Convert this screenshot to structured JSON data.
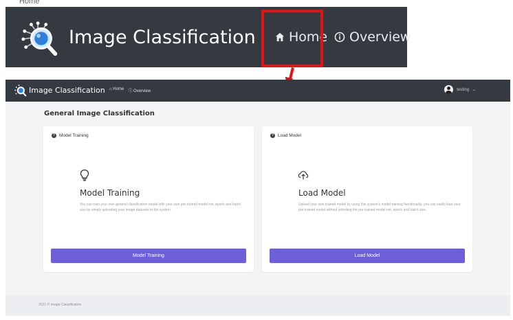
{
  "callout": {
    "top_text": "Home"
  },
  "app": {
    "title": "Image Classification",
    "nav": [
      {
        "label": "Home",
        "icon": "home-icon"
      },
      {
        "label": "Overview",
        "icon": "info-icon"
      }
    ],
    "user": {
      "name": "testing",
      "icon": "user-icon"
    }
  },
  "page": {
    "title": "General Image Classification",
    "cards": [
      {
        "header": "Model Training",
        "icon": "lightbulb-icon",
        "title": "Model Training",
        "description": "You can train your own general classification model with your own pre-trained model net, epoch and batch size by simply uploading your image datasets to the system.",
        "button": "Model Training"
      },
      {
        "header": "Load Model",
        "icon": "cloud-upload-icon",
        "title": "Load Model",
        "description": "Upload your own trained model by using this system's model training functionality, you can easily load your pre-trained model without selecting the pre-trained model net, epoch and batch size.",
        "button": "Load Model"
      }
    ]
  },
  "footer": {
    "text": "2021 © Image Classification"
  },
  "colors": {
    "navbar": "#343a40",
    "button": "#6c5fd8",
    "highlight": "#e01414"
  }
}
